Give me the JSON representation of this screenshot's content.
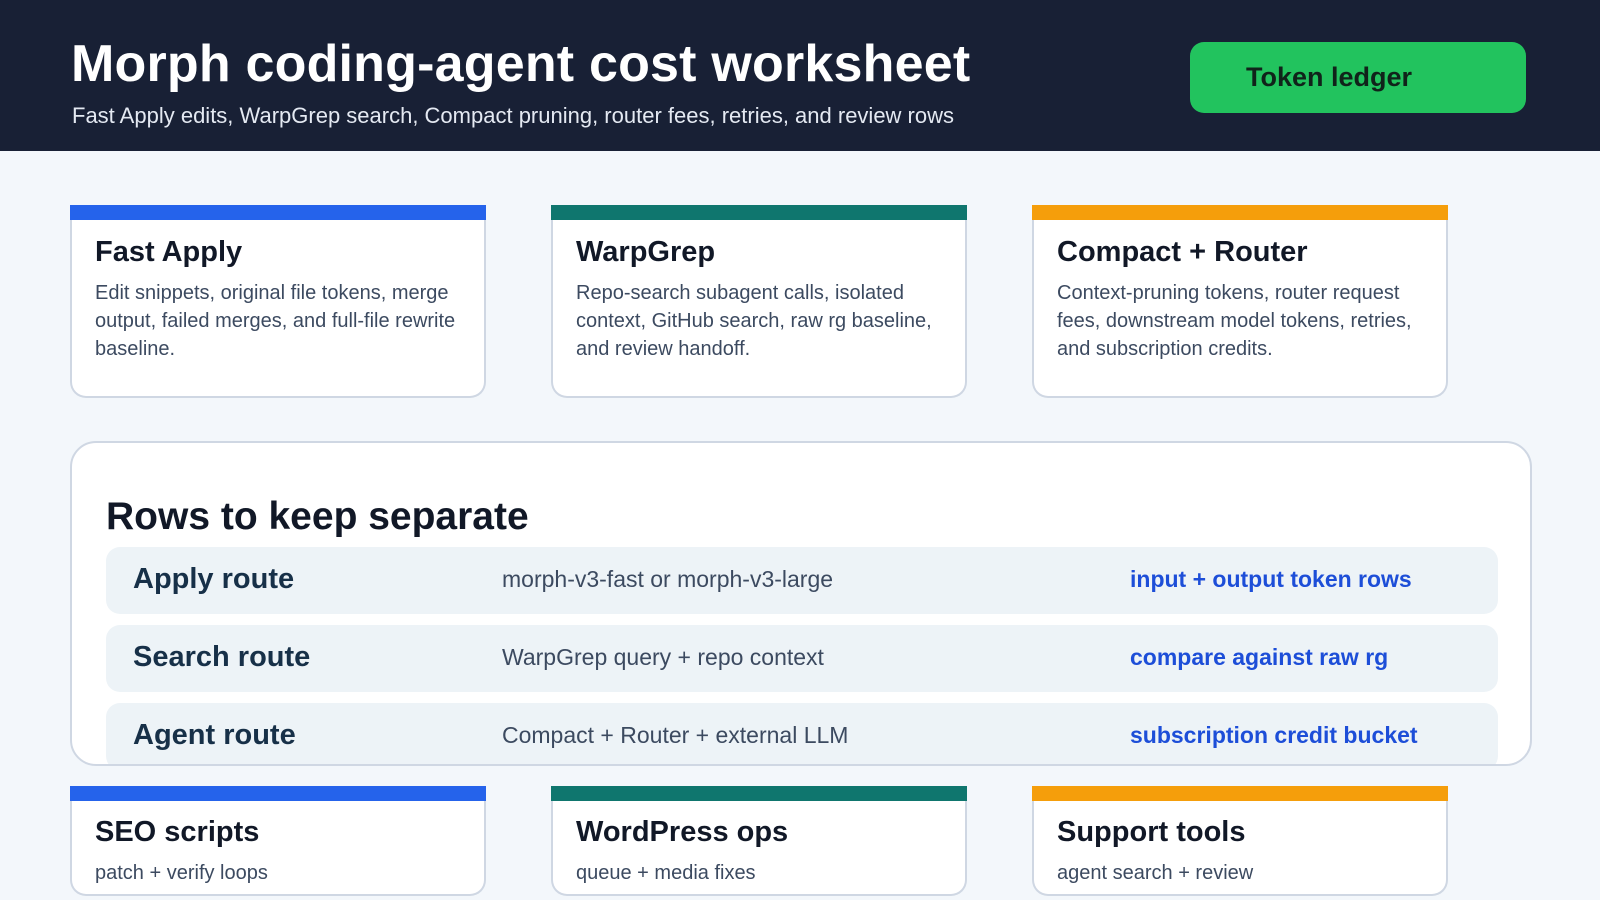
{
  "header": {
    "title": "Morph coding-agent cost worksheet",
    "subtitle": "Fast Apply edits, WarpGrep search, Compact pruning, router fees, retries, and review rows",
    "ledger_button": "Token ledger"
  },
  "colors": {
    "header_bg": "#182035",
    "accent_green": "#22c35e",
    "blue": "#2563eb",
    "teal": "#0f766e",
    "orange": "#f59e0b"
  },
  "top_cards": [
    {
      "title": "Fast Apply",
      "body": "Edit snippets, original file tokens, merge output, failed merges, and full-file rewrite baseline."
    },
    {
      "title": "WarpGrep",
      "body": "Repo-search subagent calls, isolated context, GitHub search, raw rg baseline, and review handoff."
    },
    {
      "title": "Compact + Router",
      "body": "Context-pruning tokens, router request fees, downstream model tokens, retries, and subscription credits."
    }
  ],
  "rows_section": {
    "title": "Rows to keep separate",
    "rows": [
      {
        "name": "Apply route",
        "desc": "morph-v3-fast or morph-v3-large",
        "note": "input + output token rows"
      },
      {
        "name": "Search route",
        "desc": "WarpGrep query + repo context",
        "note": "compare against raw rg"
      },
      {
        "name": "Agent route",
        "desc": "Compact + Router + external LLM",
        "note": "subscription credit bucket"
      }
    ]
  },
  "bottom_cards": [
    {
      "title": "SEO scripts",
      "body": "patch + verify loops"
    },
    {
      "title": "WordPress ops",
      "body": "queue + media fixes"
    },
    {
      "title": "Support tools",
      "body": "agent search + review"
    }
  ]
}
